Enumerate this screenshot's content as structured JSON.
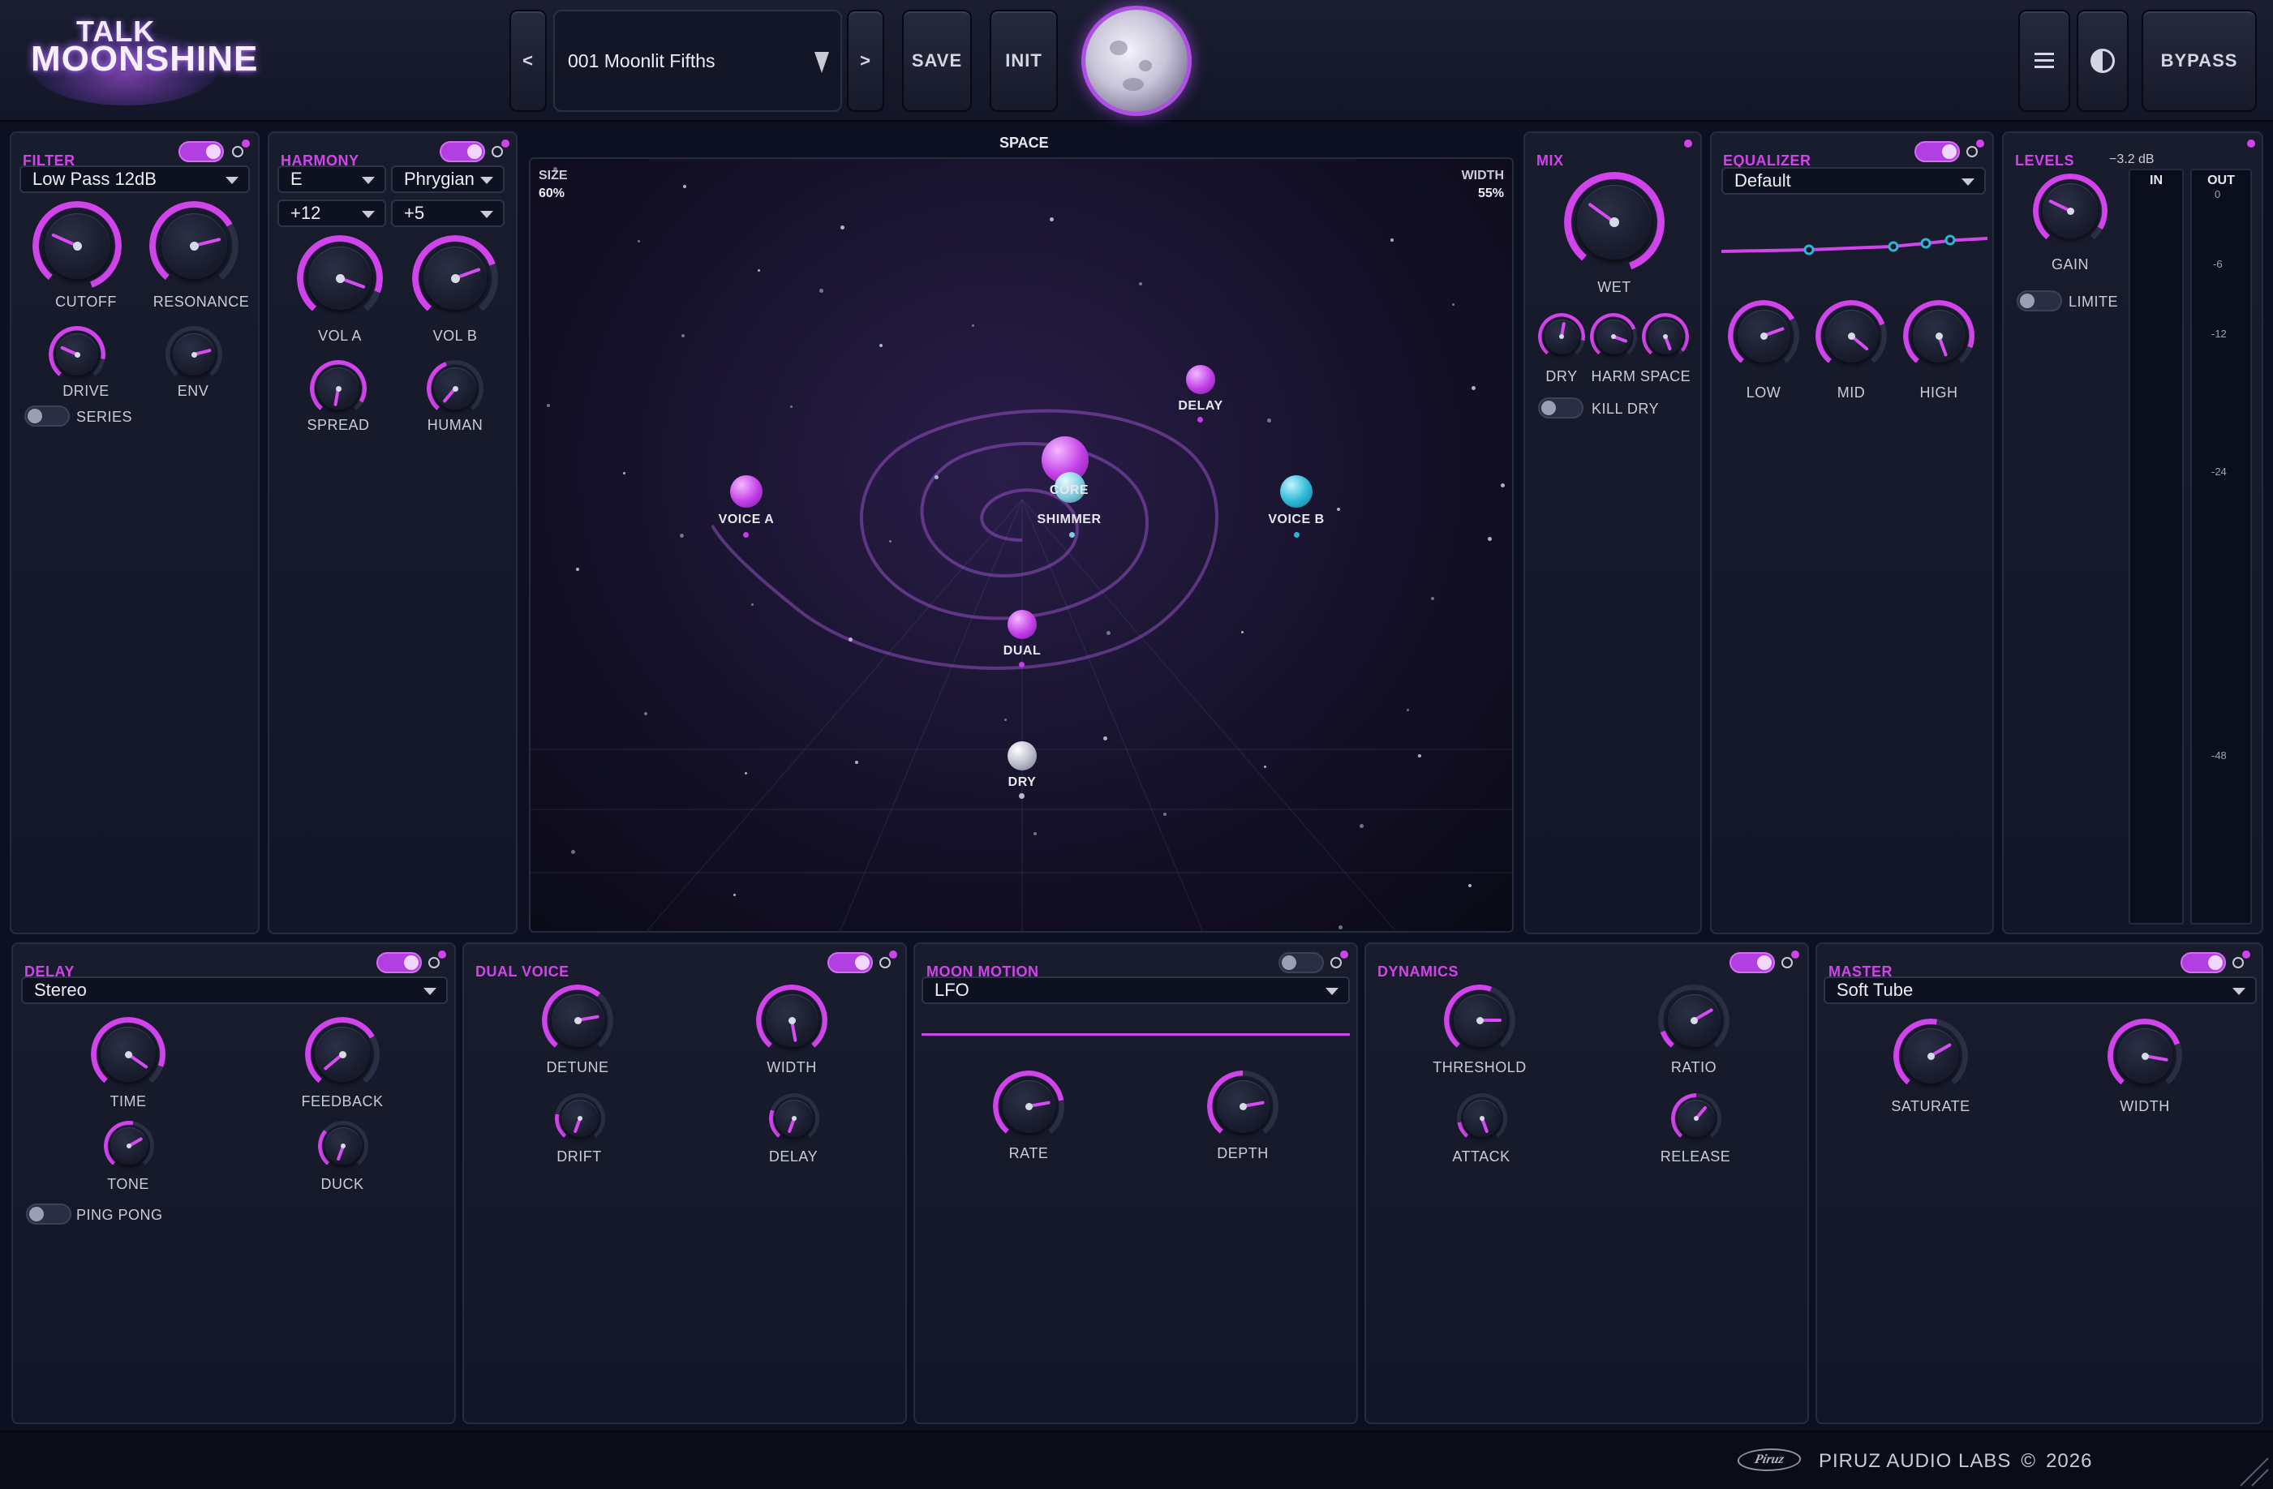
{
  "header": {
    "logo_line1": "TALK",
    "logo_line2": "MOONSHINE",
    "prev_label": "<",
    "next_label": ">",
    "preset_name": "001 Moonlit Fifths",
    "save_label": "SAVE",
    "init_label": "INIT",
    "bypass_label": "BYPASS",
    "menu_icon": "hamburger-menu-icon",
    "theme_icon": "contrast-icon"
  },
  "filter": {
    "title": "FILTER",
    "enabled": true,
    "type": "Low Pass 12dB",
    "knobs": [
      "CUTOFF",
      "RESONANCE",
      "DRIVE",
      "ENV"
    ],
    "series_label": "SERIES",
    "series_on": false
  },
  "harmony": {
    "title": "HARMONY",
    "enabled": true,
    "key": "E",
    "mode": "Phrygian",
    "interval_a": "+12",
    "interval_b": "+5",
    "knobs": [
      "VOL A",
      "VOL B",
      "SPREAD",
      "HUMAN"
    ]
  },
  "space": {
    "title": "SPACE",
    "size_label": "SIZE",
    "size_value": "60%",
    "width_label": "WIDTH",
    "width_value": "55%",
    "nodes": [
      "VOICE A",
      "CORE",
      "SHIMMER",
      "VOICE B",
      "DELAY",
      "DUAL",
      "DRY"
    ]
  },
  "mix": {
    "title": "MIX",
    "knobs": [
      "WET",
      "DRY",
      "HARM",
      "SPACE"
    ],
    "kill_dry_label": "KILL DRY",
    "kill_dry_on": false
  },
  "equalizer": {
    "title": "EQUALIZER",
    "enabled": true,
    "preset": "Default",
    "knobs": [
      "LOW",
      "MID",
      "HIGH"
    ]
  },
  "levels": {
    "title": "LEVELS",
    "gain_readout": "−3.2 dB",
    "gain_label": "GAIN",
    "limiter_label": "LIMITE",
    "limiter_on": false,
    "in_label": "IN",
    "out_label": "OUT",
    "scale": [
      "0",
      "-6",
      "-12",
      "-24",
      "-48"
    ]
  },
  "delay": {
    "title": "DELAY",
    "enabled": true,
    "mode": "Stereo",
    "knobs": [
      "TIME",
      "FEEDBACK",
      "TONE",
      "DUCK"
    ],
    "ping_pong_label": "PING PONG",
    "ping_pong_on": false
  },
  "dual_voice": {
    "title": "DUAL VOICE",
    "enabled": true,
    "knobs": [
      "DETUNE",
      "WIDTH",
      "DRIFT",
      "DELAY"
    ]
  },
  "moon_motion": {
    "title": "MOON MOTION",
    "enabled": false,
    "shape": "LFO",
    "knobs": [
      "RATE",
      "DEPTH"
    ]
  },
  "dynamics": {
    "title": "DYNAMICS",
    "enabled": true,
    "knobs": [
      "THRESHOLD",
      "RATIO",
      "ATTACK",
      "RELEASE"
    ]
  },
  "master": {
    "title": "MASTER",
    "enabled": true,
    "mode": "Soft Tube",
    "knobs": [
      "SATURATE",
      "WIDTH"
    ]
  },
  "footer": {
    "brand_logo": "Piruz",
    "company": "PIRUZ AUDIO LABS",
    "copyright": "©",
    "year": "2026"
  },
  "colors": {
    "accent": "#d144ec",
    "cyan": "#2ab7d6",
    "panel": "#151929",
    "background": "#0c1020"
  }
}
